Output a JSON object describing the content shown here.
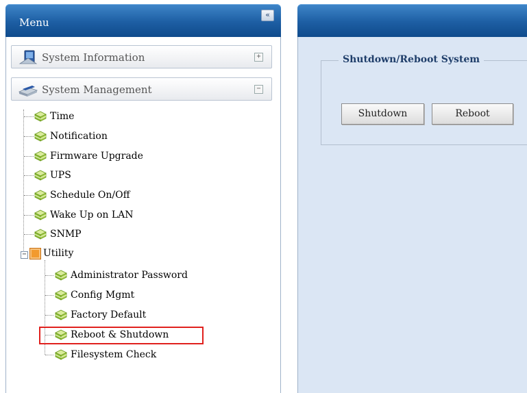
{
  "menu": {
    "title": "Menu",
    "collapse_glyph": "«",
    "sections": [
      {
        "label": "System Information",
        "toggle": "+",
        "icon": "computer-icon"
      },
      {
        "label": "System Management",
        "toggle": "−",
        "icon": "disk-icon"
      }
    ],
    "items": [
      {
        "label": "Time",
        "icon": "gem-icon"
      },
      {
        "label": "Notification",
        "icon": "gem-icon"
      },
      {
        "label": "Firmware Upgrade",
        "icon": "gem-icon"
      },
      {
        "label": "UPS",
        "icon": "gem-icon"
      },
      {
        "label": "Schedule On/Off",
        "icon": "gem-icon"
      },
      {
        "label": "Wake Up on LAN",
        "icon": "gem-icon"
      },
      {
        "label": "SNMP",
        "icon": "gem-icon"
      }
    ],
    "utility": {
      "label": "Utility",
      "toggle": "−",
      "icon": "folder-icon",
      "children": [
        {
          "label": "Administrator Password",
          "icon": "gem-icon"
        },
        {
          "label": "Config Mgmt",
          "icon": "gem-icon"
        },
        {
          "label": "Factory Default",
          "icon": "gem-icon"
        },
        {
          "label": "Reboot & Shutdown",
          "icon": "gem-icon",
          "highlighted": true
        },
        {
          "label": "Filesystem Check",
          "icon": "gem-icon"
        }
      ]
    }
  },
  "main": {
    "group_title": "Shutdown/Reboot System",
    "buttons": {
      "shutdown": "Shutdown",
      "reboot": "Reboot"
    }
  },
  "colors": {
    "header": "#1d5ea3",
    "content_bg": "#dbe6f4",
    "legend_text": "#1f3e6a",
    "highlight": "#e0201d",
    "gem_light": "#c7e07a",
    "gem_dark": "#6a9a1c"
  }
}
